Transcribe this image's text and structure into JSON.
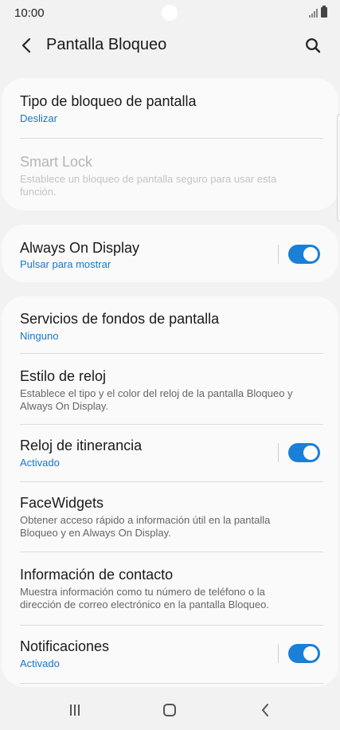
{
  "status_bar": {
    "time": "10:00"
  },
  "app_bar": {
    "title": "Pantalla Bloqueo"
  },
  "sections": {
    "lock": {
      "lock_type": {
        "title": "Tipo de bloqueo de pantalla",
        "value": "Deslizar"
      },
      "smart_lock": {
        "title": "Smart Lock",
        "description": "Establece un bloqueo de pantalla seguro para usar esta función."
      }
    },
    "aod": {
      "always_on": {
        "title": "Always On Display",
        "value": "Pulsar para mostrar",
        "toggle_on": true
      }
    },
    "more": {
      "wallpaper": {
        "title": "Servicios de fondos de pantalla",
        "value": "Ninguno"
      },
      "clock_style": {
        "title": "Estilo de reloj",
        "description": "Establece el tipo y el color del reloj de la pantalla Bloqueo y Always On Display."
      },
      "roaming_clock": {
        "title": "Reloj de itinerancia",
        "value": "Activado",
        "toggle_on": true
      },
      "facewidgets": {
        "title": "FaceWidgets",
        "description": "Obtener acceso rápido a información útil en la pantalla Bloqueo y en Always On Display."
      },
      "contact_info": {
        "title": "Información de contacto",
        "description": "Muestra información como tu número de teléfono o la dirección de correo electrónico en la pantalla Bloqueo."
      },
      "notifications": {
        "title": "Notificaciones",
        "value": "Activado",
        "toggle_on": true
      }
    }
  },
  "colors": {
    "accent": "#1a7fd6",
    "link": "#1976c8",
    "background": "#f2f2f2",
    "card": "#fafafa"
  },
  "icons": {
    "back": "chevron-left-icon",
    "search": "search-icon",
    "recents": "recents-icon",
    "home": "home-icon",
    "nav_back": "nav-back-icon"
  }
}
